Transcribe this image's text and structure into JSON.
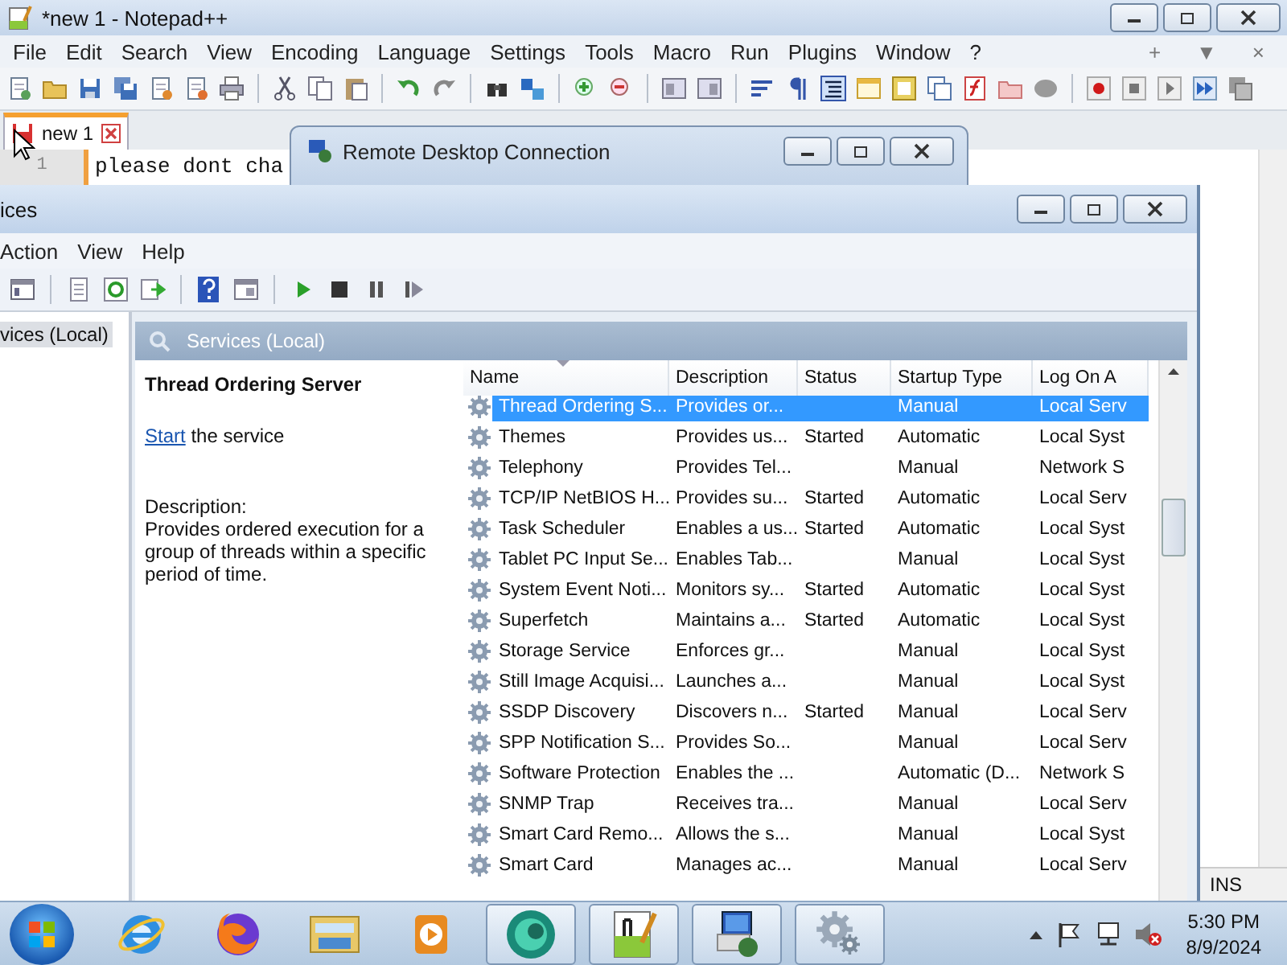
{
  "notepad": {
    "title": "*new 1 - Notepad++",
    "menu": [
      "File",
      "Edit",
      "Search",
      "View",
      "Encoding",
      "Language",
      "Settings",
      "Tools",
      "Macro",
      "Run",
      "Plugins",
      "Window",
      "?"
    ],
    "menu_right": [
      "+",
      "▼",
      "×"
    ],
    "tabs": [
      {
        "label": "new 1",
        "selected": true
      }
    ],
    "lines": [
      {
        "number": "1",
        "text": "please dont cha"
      }
    ],
    "status_bar": {
      "mode": "INS"
    }
  },
  "remote_desktop": {
    "title": "Remote Desktop Connection"
  },
  "services": {
    "title": "ices",
    "menu": [
      "Action",
      "View",
      "Help"
    ],
    "tree": [
      {
        "label": "vices (Local)",
        "selected": true
      }
    ],
    "panel_title": "Services (Local)",
    "detail": {
      "name": "Thread Ordering Server",
      "action_link": "Start",
      "action_rest": "the service",
      "description_label": "Description:",
      "description": "Provides ordered execution for a group of threads within a specific period of time."
    },
    "table": {
      "columns": [
        {
          "label": "Name",
          "sorted": true
        },
        {
          "label": "Description",
          "sorted": false
        },
        {
          "label": "Status",
          "sorted": false
        },
        {
          "label": "Startup Type",
          "sorted": false
        },
        {
          "label": "Log On A",
          "sorted": false
        }
      ],
      "rows": [
        {
          "name": "Thread Ordering S...",
          "description": "Provides or...",
          "startup_type": "Manual",
          "log_on_as": "Local Serv",
          "selected": true
        },
        {
          "name": "Themes",
          "description": "Provides us...",
          "status": "Started",
          "startup_type": "Automatic",
          "log_on_as": "Local Syst",
          "selected": false
        },
        {
          "name": "Telephony",
          "description": "Provides Tel...",
          "startup_type": "Manual",
          "log_on_as": "Network S",
          "selected": false
        },
        {
          "name": "TCP/IP NetBIOS H...",
          "description": "Provides su...",
          "status": "Started",
          "startup_type": "Automatic",
          "log_on_as": "Local Serv",
          "selected": false
        },
        {
          "name": "Task Scheduler",
          "description": "Enables a us...",
          "status": "Started",
          "startup_type": "Automatic",
          "log_on_as": "Local Syst",
          "selected": false
        },
        {
          "name": "Tablet PC Input Se...",
          "description": "Enables Tab...",
          "startup_type": "Manual",
          "log_on_as": "Local Syst",
          "selected": false
        },
        {
          "name": "System Event Noti...",
          "description": "Monitors sy...",
          "status": "Started",
          "startup_type": "Automatic",
          "log_on_as": "Local Syst",
          "selected": false
        },
        {
          "name": "Superfetch",
          "description": "Maintains a...",
          "status": "Started",
          "startup_type": "Automatic",
          "log_on_as": "Local Syst",
          "selected": false
        },
        {
          "name": "Storage Service",
          "description": "Enforces gr...",
          "startup_type": "Manual",
          "log_on_as": "Local Syst",
          "selected": false
        },
        {
          "name": "Still Image Acquisi...",
          "description": "Launches a...",
          "startup_type": "Manual",
          "log_on_as": "Local Syst",
          "selected": false
        },
        {
          "name": "SSDP Discovery",
          "description": "Discovers n...",
          "status": "Started",
          "startup_type": "Manual",
          "log_on_as": "Local Serv",
          "selected": false
        },
        {
          "name": "SPP Notification S...",
          "description": "Provides So...",
          "startup_type": "Manual",
          "log_on_as": "Local Serv",
          "selected": false
        },
        {
          "name": "Software Protection",
          "description": "Enables the ...",
          "startup_type": "Automatic (D...",
          "log_on_as": "Network S",
          "selected": false
        },
        {
          "name": "SNMP Trap",
          "description": "Receives tra...",
          "startup_type": "Manual",
          "log_on_as": "Local Serv",
          "selected": false
        },
        {
          "name": "Smart Card Remo...",
          "description": "Allows the s...",
          "startup_type": "Manual",
          "log_on_as": "Local Syst",
          "selected": false
        },
        {
          "name": "Smart Card",
          "description": "Manages ac...",
          "startup_type": "Manual",
          "log_on_as": "Local Serv",
          "selected": false
        }
      ]
    }
  },
  "taskbar": {
    "apps": [
      {
        "kind": "browser_e",
        "running": false
      },
      {
        "kind": "browser_fox",
        "running": false
      },
      {
        "kind": "folder",
        "running": false
      },
      {
        "kind": "media",
        "running": false
      },
      {
        "kind": "circle",
        "running": true
      },
      {
        "kind": "notepad",
        "running": true
      },
      {
        "kind": "remote",
        "running": true
      },
      {
        "kind": "gear",
        "running": true
      }
    ],
    "clock": {
      "time": "5:30 PM",
      "date": "8/9/2024"
    }
  }
}
